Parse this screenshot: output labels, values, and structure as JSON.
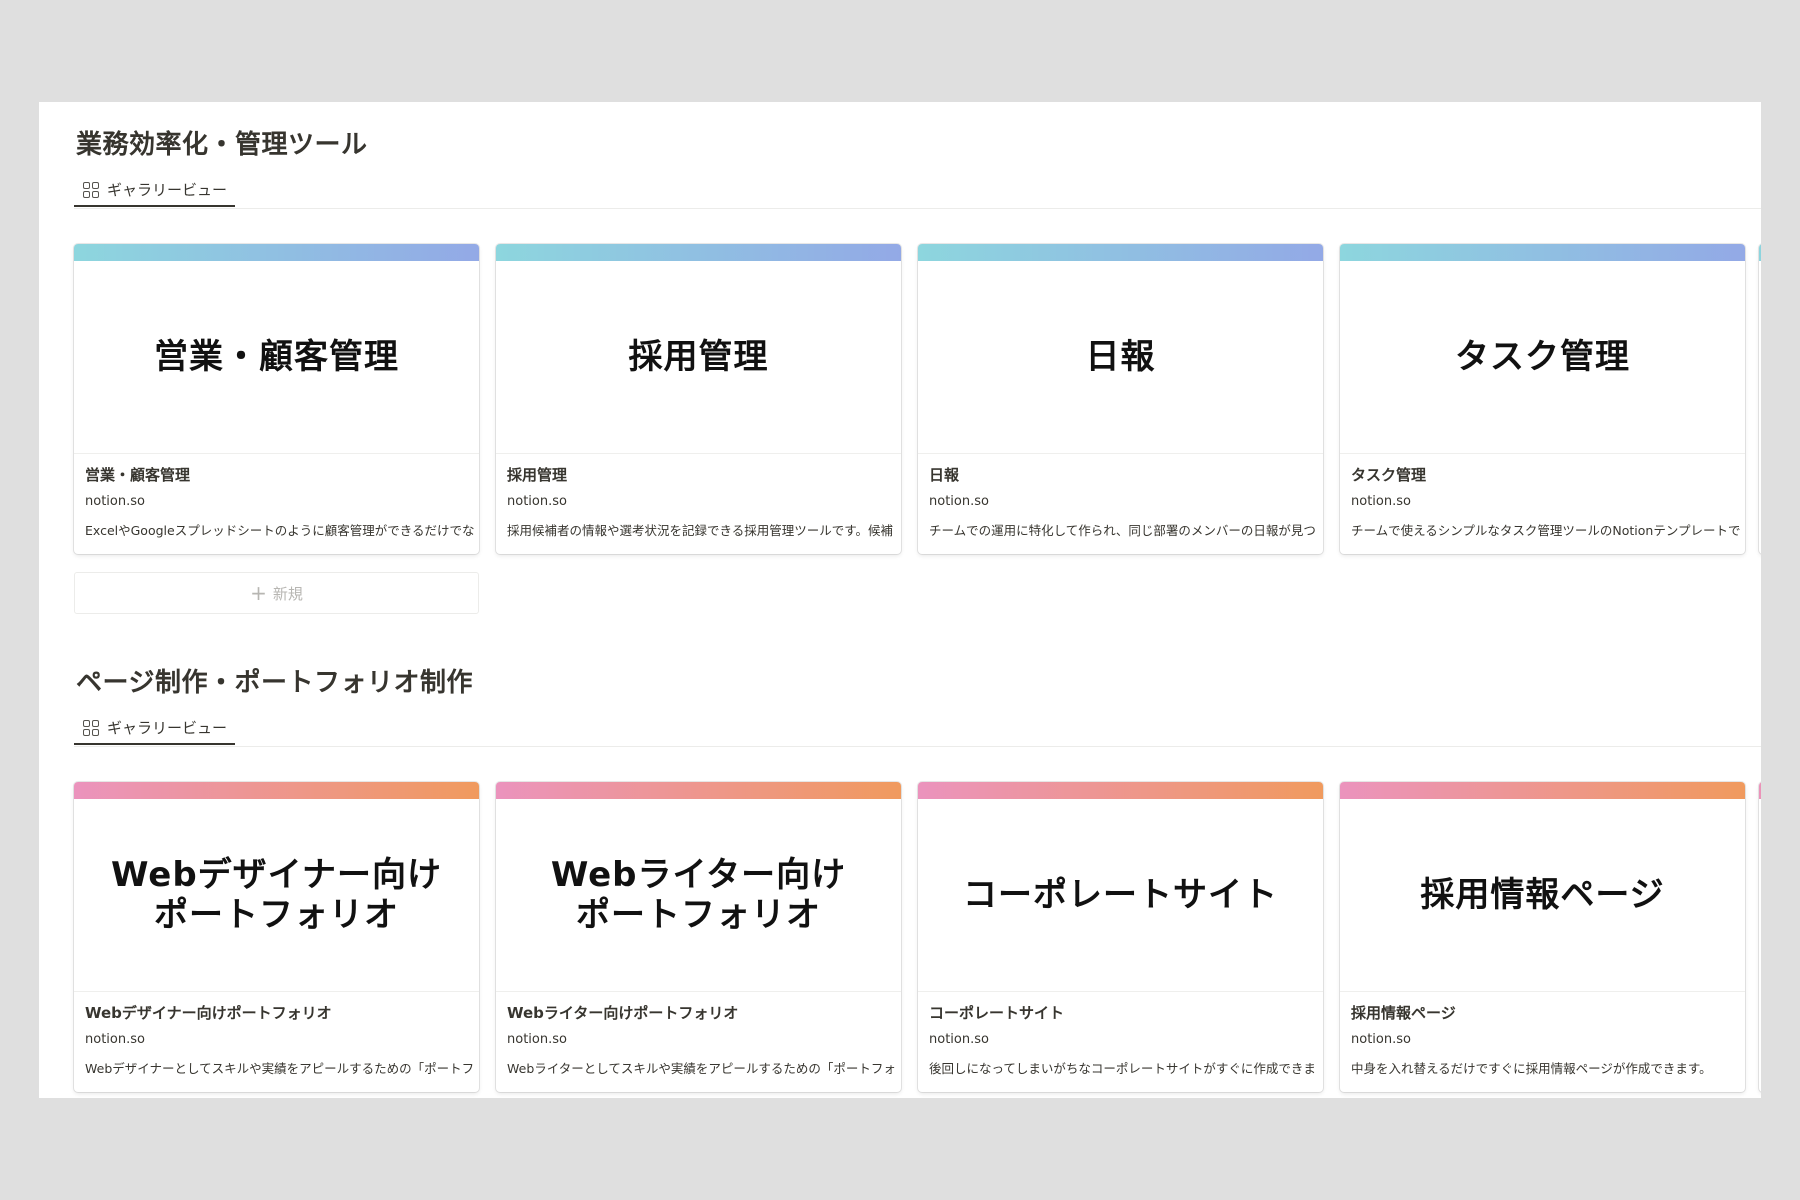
{
  "sections": [
    {
      "title": "業務効率化・管理ツール",
      "tab_label": "ギャラリービュー",
      "new_label": "新規",
      "cards": [
        {
          "cover": "営業・顧客管理",
          "title": "営業・顧客管理",
          "domain": "notion.so",
          "desc": "ExcelやGoogleスプレッドシートのように顧客管理ができるだけでな"
        },
        {
          "cover": "採用管理",
          "title": "採用管理",
          "domain": "notion.so",
          "desc": "採用候補者の情報や選考状況を記録できる採用管理ツールです。候補"
        },
        {
          "cover": "日報",
          "title": "日報",
          "domain": "notion.so",
          "desc": "チームでの運用に特化して作られ、同じ部署のメンバーの日報が見つ"
        },
        {
          "cover": "タスク管理",
          "title": "タスク管理",
          "domain": "notion.so",
          "desc": "チームで使えるシンプルなタスク管理ツールのNotionテンプレートで"
        }
      ]
    },
    {
      "title": "ページ制作・ポートフォリオ制作",
      "tab_label": "ギャラリービュー",
      "cards": [
        {
          "cover": "Webデザイナー向け\nポートフォリオ",
          "title": "Webデザイナー向けポートフォリオ",
          "domain": "notion.so",
          "desc": "Webデザイナーとしてスキルや実績をアピールするための「ポートフ"
        },
        {
          "cover": "Webライター向け\nポートフォリオ",
          "title": "Webライター向けポートフォリオ",
          "domain": "notion.so",
          "desc": "Webライターとしてスキルや実績をアピールするための「ポートフォ"
        },
        {
          "cover": "コーポレートサイト",
          "title": "コーポレートサイト",
          "domain": "notion.so",
          "desc": "後回しになってしまいがちなコーポレートサイトがすぐに作成できま"
        },
        {
          "cover": "採用情報ページ",
          "title": "採用情報ページ",
          "domain": "notion.so",
          "desc": "中身を入れ替えるだけですぐに採用情報ページが作成できます。"
        }
      ]
    }
  ],
  "colors": {
    "accent_blue_start": "#8dd6de",
    "accent_blue_end": "#93a9e6",
    "accent_pink_start": "#eb93bd",
    "accent_pink_end": "#f09a5e"
  }
}
